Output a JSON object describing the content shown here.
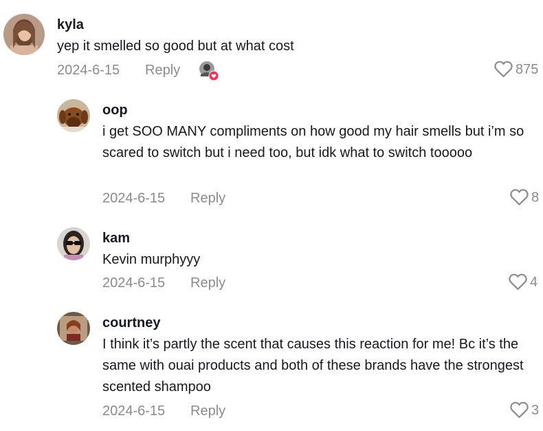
{
  "comments": [
    {
      "username": "kyla",
      "text": "yep it smelled so good but at what cost",
      "date": "2024-6-15",
      "reply_label": "Reply",
      "likes": "875",
      "liked_by_creator": true
    },
    {
      "username": "oop",
      "text": "i get SOO MANY compliments on how good my hair smells but i’m so scared to switch but i need too, but idk what to switch tooooo",
      "date": "2024-6-15",
      "reply_label": "Reply",
      "likes": "8"
    },
    {
      "username": "kam",
      "text": "Kevin murphyyy",
      "date": "2024-6-15",
      "reply_label": "Reply",
      "likes": "4"
    },
    {
      "username": "courtney",
      "text": "I think it’s partly the scent that causes this reaction for me! Bc it’s the same with ouai products and both of these brands have the strongest scented shampoo",
      "date": "2024-6-15",
      "reply_label": "Reply",
      "likes": "3"
    }
  ],
  "colors": {
    "text": "#161823",
    "secondary": "#8a8b91",
    "heart_badge": "#fe2c55"
  },
  "icons": {
    "like": "heart-outline-icon",
    "creator_liked_badge": "heart-badge-icon"
  }
}
